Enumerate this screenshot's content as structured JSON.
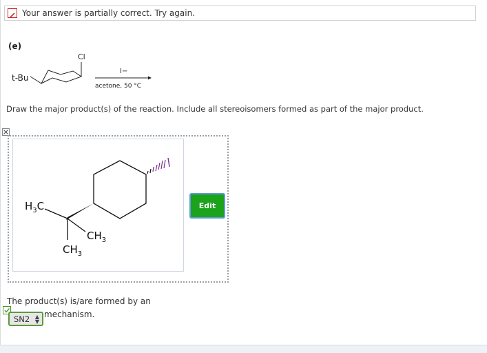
{
  "feedback": {
    "message": "Your answer is partially correct.  Try again."
  },
  "question": {
    "part": "(e)",
    "reactant_substituent_1": "t-Bu",
    "reactant_substituent_2": "Cl",
    "reagent": "I−",
    "conditions": "acetone, 50 °C",
    "instructions": "Draw the major product(s) of the reaction. Include all stereoisomers formed as part of the major product."
  },
  "product_drawing": {
    "h3c_label_h": "H",
    "h3c_label_sub": "3",
    "h3c_label_c": "C",
    "ch3_right_main": "CH",
    "ch3_right_sub": "3",
    "ch3_bottom_main": "CH",
    "ch3_bottom_sub": "3",
    "edit_label": "Edit"
  },
  "mechanism": {
    "prompt": "The product(s) is/are formed by an",
    "selected": "SN2",
    "suffix": "mechanism."
  },
  "colors": {
    "edit_button": "#1ba31b",
    "wedge_purple": "#7b2d8e",
    "partial_icon": "#c9302c",
    "check_green": "#4c9a2a"
  }
}
